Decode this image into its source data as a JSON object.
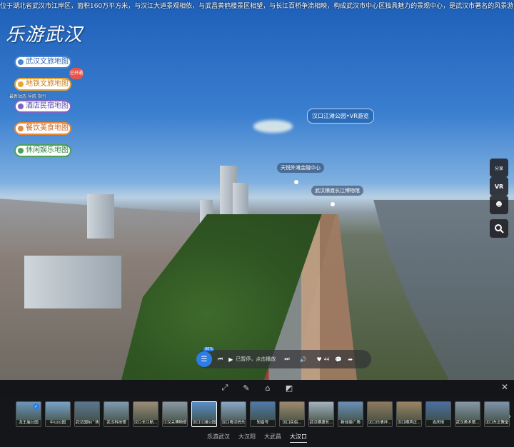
{
  "marquee": "位于湖北省武汉市江岸区，面积160万平方米，与汉江大道景观相依，与武昌黄鹤楼景区相望，与长江百桥争流相映，构成武汉市中心区独具魅力的景观中心，是武汉市著名的风景游览胜地，“两江四岸八林带，火树银花不夜天”，这里",
  "logo": "乐游武汉",
  "menu": [
    {
      "label": "武汉文旅地图"
    },
    {
      "label": "地铁文旅地图"
    },
    {
      "label": "酒店民宿地图"
    },
    {
      "label": "餐饮美食地图"
    },
    {
      "label": "休闲娱乐地图"
    }
  ],
  "new_badge": "已开通",
  "tip": "最新动态·导航·指引",
  "hotspots": {
    "main": "汉口江滩公园•VR游览",
    "finance": "天悦外滩金融中心",
    "museum": "武汉横渡长江博物馆"
  },
  "right_controls": {
    "share": "分享",
    "vr": "VR",
    "search": "search"
  },
  "player": {
    "badge": "96%",
    "status": "已暂停，点击播放",
    "likes": "44"
  },
  "scenes": [
    {
      "label": "龙王庙公园",
      "color": "#6d95b8",
      "active": false,
      "checked": true
    },
    {
      "label": "中山公园",
      "color": "#7aa2c8",
      "active": false,
      "checked": false
    },
    {
      "label": "武汉国际广场",
      "color": "#5d7690",
      "active": false,
      "checked": false
    },
    {
      "label": "武汉科技馆",
      "color": "#7f9ab0",
      "active": false,
      "checked": false
    },
    {
      "label": "汉口长江航...",
      "color": "#9a8c78",
      "active": false,
      "checked": false
    },
    {
      "label": "江汉关博物馆",
      "color": "#8a98a4",
      "active": false,
      "checked": false
    },
    {
      "label": "汉口江滩公园",
      "color": "#5a8ec6",
      "active": true,
      "checked": false
    },
    {
      "label": "汉口粤汉码头",
      "color": "#8aa8c6",
      "active": false,
      "checked": false
    },
    {
      "label": "知音号",
      "color": "#4f7aa8",
      "active": false,
      "checked": false
    },
    {
      "label": "汉口民俗...",
      "color": "#9e8a72",
      "active": false,
      "checked": false
    },
    {
      "label": "武汉横渡长...",
      "color": "#a3b2be",
      "active": false,
      "checked": false
    },
    {
      "label": "新佳丽广场",
      "color": "#6b8fb6",
      "active": false,
      "checked": false
    },
    {
      "label": "汉口日清洋...",
      "color": "#8f7a62",
      "active": false,
      "checked": false
    },
    {
      "label": "汉口横滨正...",
      "color": "#9a8466",
      "active": false,
      "checked": false
    },
    {
      "label": "吉庆街",
      "color": "#4c6fa0",
      "active": false,
      "checked": false
    },
    {
      "label": "武汉美术馆...",
      "color": "#8798a8",
      "active": false,
      "checked": false
    },
    {
      "label": "汉口东正教堂",
      "color": "#7e93ab",
      "active": false,
      "checked": false
    }
  ],
  "groups": [
    {
      "label": "乐游武汉",
      "active": false
    },
    {
      "label": "大汉阳",
      "active": false
    },
    {
      "label": "大武昌",
      "active": false
    },
    {
      "label": "大汉口",
      "active": true
    }
  ]
}
